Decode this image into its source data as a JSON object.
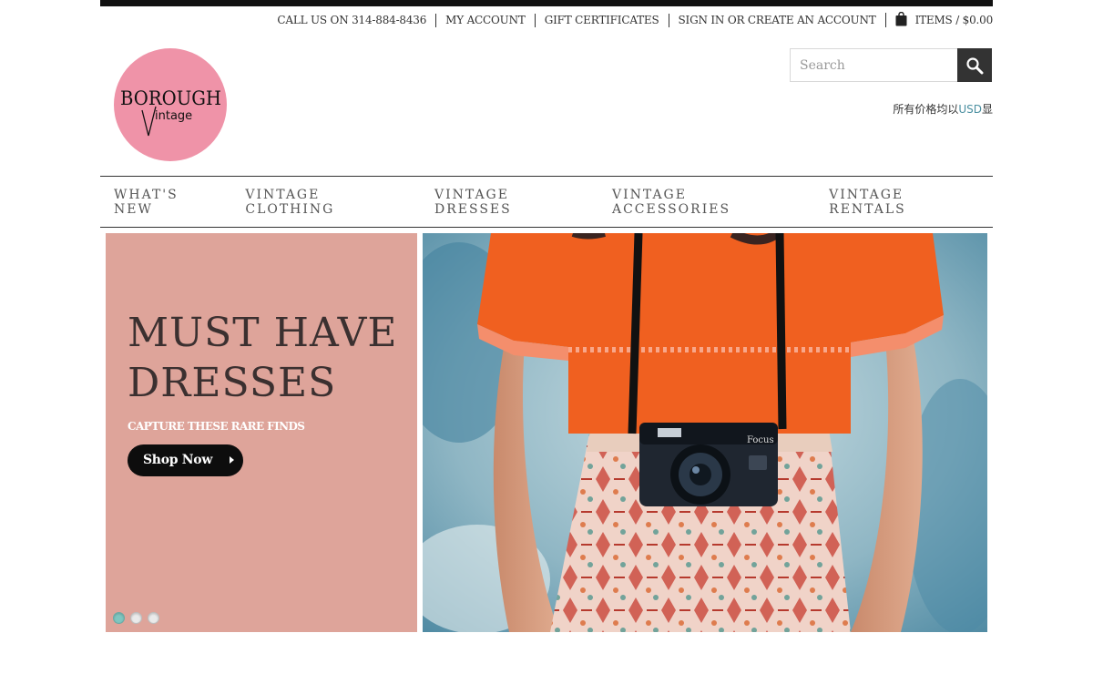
{
  "header": {
    "phone_label": "CALL US ON 314-884-8436",
    "my_account": "MY ACCOUNT",
    "gift_certificates": "GIFT CERTIFICATES",
    "sign_in": "SIGN IN OR CREATE AN ACCOUNT",
    "cart": "ITEMS / $0.00"
  },
  "logo": {
    "line1": "BOROUGH",
    "line2": "intage"
  },
  "search": {
    "placeholder": "Search"
  },
  "currency": {
    "prefix": "所有价格均以",
    "code": "USD",
    "suffix": "显"
  },
  "nav": {
    "items": [
      "WHAT'S NEW",
      "VINTAGE CLOTHING",
      "VINTAGE DRESSES",
      "VINTAGE ACCESSORIES",
      "VINTAGE RENTALS"
    ]
  },
  "hero": {
    "heading_line1": "MUST HAVE",
    "heading_line2": "DRESSES",
    "subheading": "CAPTURE THESE RARE FINDS",
    "button": "Shop Now",
    "slide_count": 3,
    "active_slide": 1
  },
  "photo": {
    "camera_text": "Focus"
  },
  "colors": {
    "logo_pink": "#ef93a8",
    "hero_panel": "#dea49a",
    "dot_active": "#7fc6c0",
    "currency_accent": "#4a8fa0"
  }
}
